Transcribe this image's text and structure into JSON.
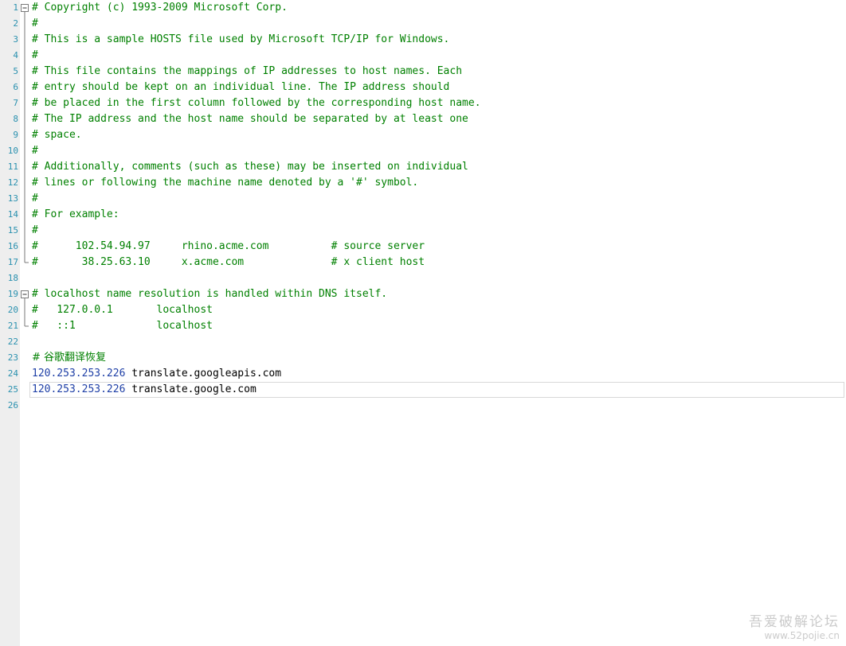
{
  "editor": {
    "lines": [
      {
        "n": "1",
        "text": "# Copyright (c) 1993-2009 Microsoft Corp."
      },
      {
        "n": "2",
        "text": "#"
      },
      {
        "n": "3",
        "text": "# This is a sample HOSTS file used by Microsoft TCP/IP for Windows."
      },
      {
        "n": "4",
        "text": "#"
      },
      {
        "n": "5",
        "text": "# This file contains the mappings of IP addresses to host names. Each"
      },
      {
        "n": "6",
        "text": "# entry should be kept on an individual line. The IP address should"
      },
      {
        "n": "7",
        "text": "# be placed in the first column followed by the corresponding host name."
      },
      {
        "n": "8",
        "text": "# The IP address and the host name should be separated by at least one"
      },
      {
        "n": "9",
        "text": "# space."
      },
      {
        "n": "10",
        "text": "#"
      },
      {
        "n": "11",
        "text": "# Additionally, comments (such as these) may be inserted on individual"
      },
      {
        "n": "12",
        "text": "# lines or following the machine name denoted by a '#' symbol."
      },
      {
        "n": "13",
        "text": "#"
      },
      {
        "n": "14",
        "text": "# For example:"
      },
      {
        "n": "15",
        "text": "#"
      },
      {
        "n": "16",
        "text": "#      102.54.94.97     rhino.acme.com          # source server"
      },
      {
        "n": "17",
        "text": "#       38.25.63.10     x.acme.com              # x client host"
      },
      {
        "n": "18",
        "text": ""
      },
      {
        "n": "19",
        "text": "# localhost name resolution is handled within DNS itself."
      },
      {
        "n": "20",
        "text": "#   127.0.0.1       localhost"
      },
      {
        "n": "21",
        "text": "#   ::1             localhost"
      },
      {
        "n": "22",
        "text": ""
      },
      {
        "n": "23",
        "text": "# 谷歌翻译恢复"
      },
      {
        "n": "24",
        "ip": "120.253.253.226",
        "host": " translate.googleapis.com"
      },
      {
        "n": "25",
        "ip": "120.253.253.226",
        "host": " translate.google.com"
      },
      {
        "n": "26",
        "text": ""
      }
    ]
  },
  "watermark": {
    "line1": "吾爱破解论坛",
    "line2": "www.52pojie.cn"
  },
  "colors": {
    "comment": "#008000",
    "ip": "#1e3fa6",
    "line_number": "#2b91af",
    "gutter": "#eeeeee"
  }
}
